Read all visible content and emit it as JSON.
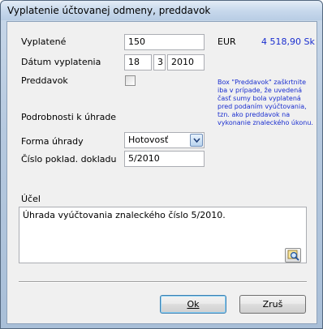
{
  "window": {
    "title": "Vyplatenie účtovanej odmeny, preddavok"
  },
  "form": {
    "paid_label": "Vyplatené",
    "paid_value": "150",
    "currency": "EUR",
    "amount_display": "4 518,90 Sk",
    "date_label": "Dátum vyplatenia",
    "date_day": "18",
    "date_month": "3",
    "date_year": "2010",
    "advance_label": "Preddavok",
    "advance_checked": false,
    "advance_help": "Box \"Preddavok\" zaškrtnite iba v prípade, že uvedená časť sumy bola vyplatená pred podaním vyúčtovania, tzn. ako preddavok na vykonanie znaleckého úkonu.",
    "payment_details_heading": "Podrobnosti k úhrade",
    "payment_form_label": "Forma úhrady",
    "payment_form_value": "Hotovosť",
    "receipt_label": "Číslo poklad. dokladu",
    "receipt_value": "5/2010",
    "purpose_label": "Účel",
    "purpose_value": "Úhrada vyúčtovania znaleckého číslo 5/2010."
  },
  "buttons": {
    "ok_label": "Ok",
    "cancel_label": "Zruš"
  }
}
